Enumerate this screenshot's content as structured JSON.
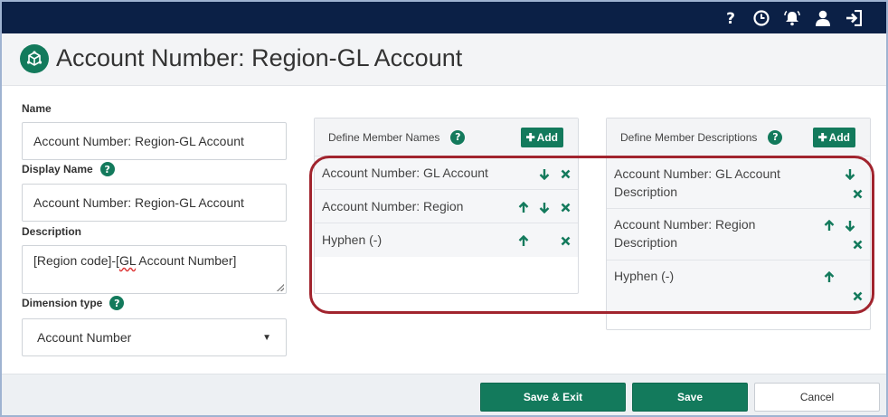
{
  "topbar": {
    "icons": [
      "help-icon",
      "history-icon",
      "notifications-icon",
      "user-icon",
      "sign-out-icon"
    ],
    "bg_color": "#0b2046"
  },
  "header": {
    "title": "Account Number: Region-GL Account",
    "logo_icon": "dimension-cube-icon"
  },
  "form": {
    "name_label": "Name",
    "name_value": "Account Number: Region-GL Account",
    "display_name_label": "Display Name",
    "display_name_value": "Account Number: Region-GL Account",
    "description_label": "Description",
    "description_value_part1": "[Region code]-[",
    "description_value_squiggle": "GL",
    "description_value_part2": " Account Number]",
    "dimension_type_label": "Dimension type",
    "dimension_type_value": "Account Number",
    "help_glyph": "?"
  },
  "member_names": {
    "title": "Define Member Names",
    "add_label": "Add",
    "items": [
      {
        "label": "Account Number: GL Account"
      },
      {
        "label": "Account Number: Region"
      },
      {
        "label": "Hyphen (-)"
      }
    ]
  },
  "member_descriptions": {
    "title": "Define Member Descriptions",
    "add_label": "Add",
    "items": [
      {
        "line1": "Account Number: GL Account",
        "line2": "Description"
      },
      {
        "line1": "Account Number: Region",
        "line2": "Description"
      },
      {
        "line1": "Hyphen (-)",
        "line2": ""
      }
    ]
  },
  "footer": {
    "save_exit_label": "Save & Exit",
    "save_label": "Save",
    "cancel_label": "Cancel"
  },
  "colors": {
    "accent": "#137a5c",
    "highlight": "#a1242e"
  }
}
